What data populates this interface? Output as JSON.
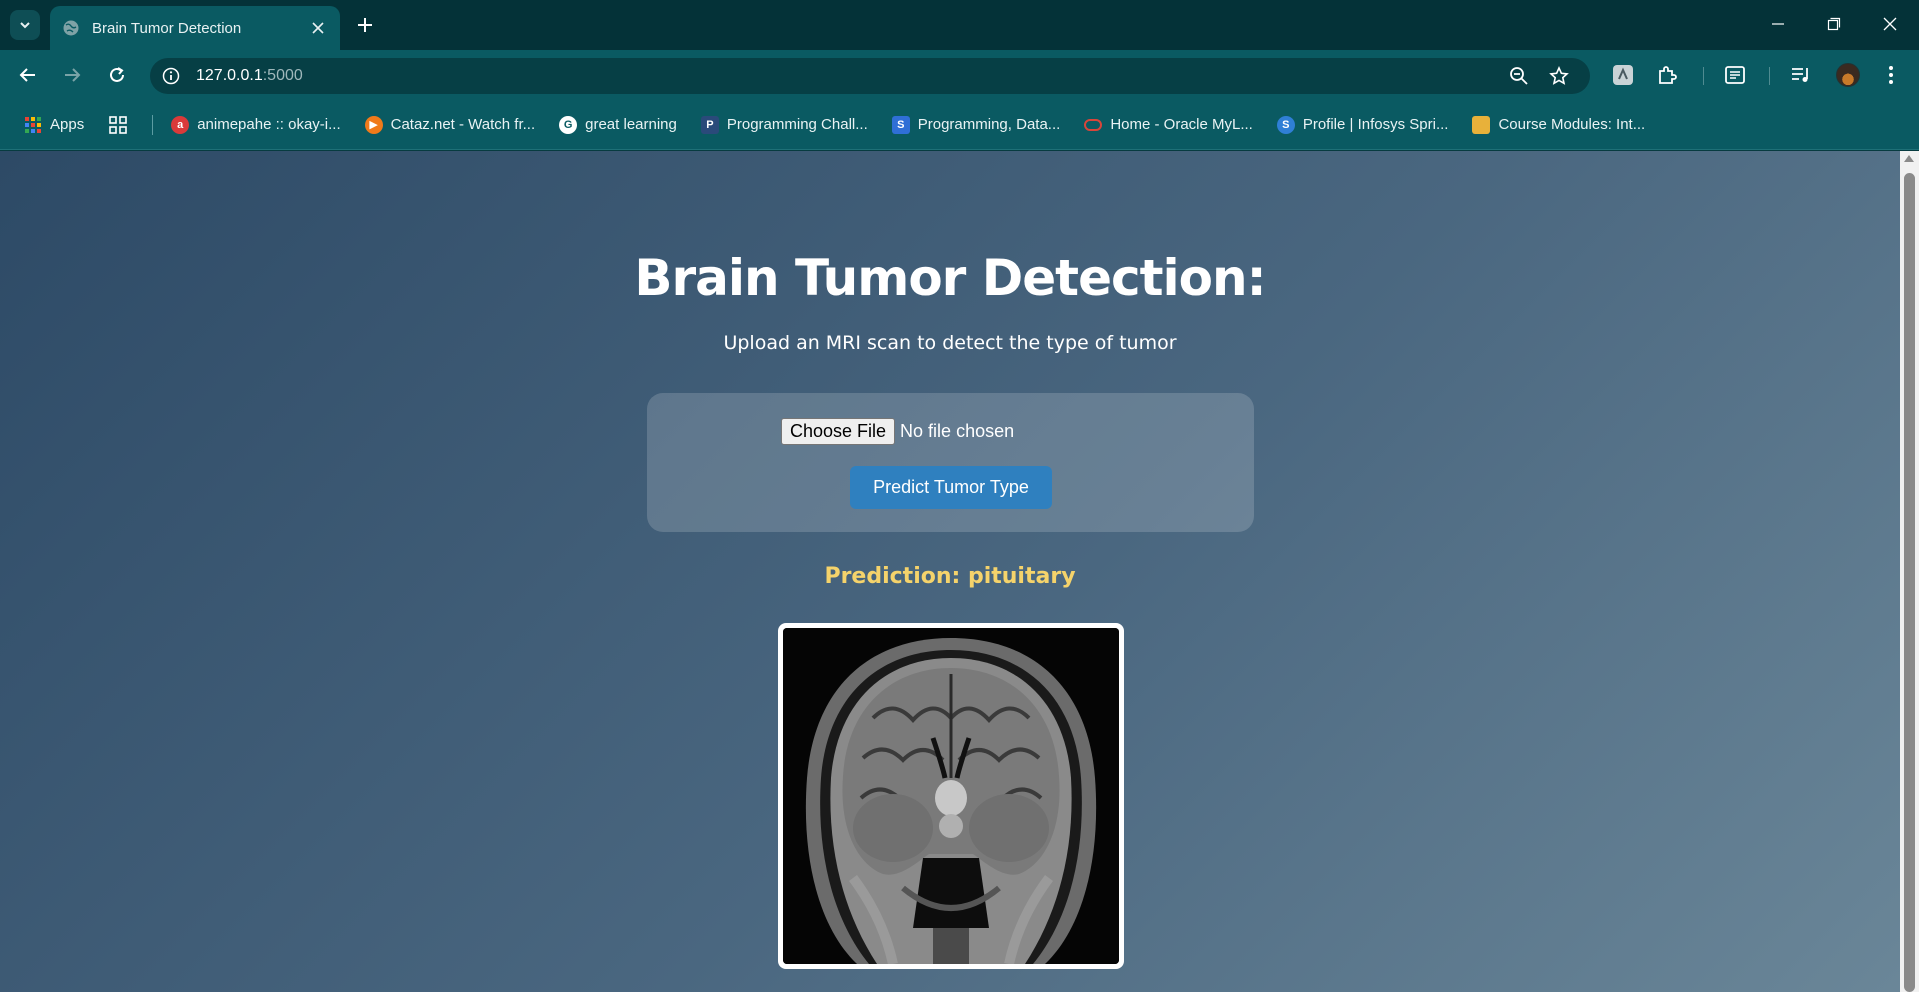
{
  "browser": {
    "tab_title": "Brain Tumor Detection",
    "url_host": "127.0.0.1",
    "url_port": ":5000",
    "icons": [
      "tab-search-icon",
      "globe-icon",
      "close-icon",
      "plus-icon",
      "minimize-icon",
      "restore-icon",
      "close-window-icon",
      "back-icon",
      "forward-icon",
      "reload-icon",
      "info-icon",
      "zoom-out-icon",
      "star-icon",
      "extension-puzzle-icon",
      "reading-list-icon",
      "media-icon",
      "menu-dots-icon"
    ]
  },
  "bookmarks": {
    "apps": "Apps",
    "items": [
      {
        "label": "animepahe :: okay-i...",
        "color": "#d93a3a"
      },
      {
        "label": "Cataz.net - Watch fr...",
        "color": "#f07a1a"
      },
      {
        "label": "great learning",
        "color": "#ffffff"
      },
      {
        "label": "Programming Chall...",
        "color": "#2a4a7a"
      },
      {
        "label": "Programming, Data...",
        "color": "#2f6fd6"
      },
      {
        "label": "Home - Oracle MyL...",
        "color": "#d9453a"
      },
      {
        "label": "Profile | Infosys Spri...",
        "color": "#2f7fd6"
      },
      {
        "label": "Course Modules: Int...",
        "color": "#e8b13a"
      }
    ]
  },
  "page": {
    "title": "Brain Tumor Detection:",
    "subtitle": "Upload an MRI scan to detect the type of tumor",
    "choose_file": "Choose File",
    "file_status": "No file chosen",
    "predict_button": "Predict Tumor Type",
    "prediction": "Prediction: pituitary",
    "accent_color": "#2f80bf",
    "prediction_color": "#f5d36b"
  }
}
